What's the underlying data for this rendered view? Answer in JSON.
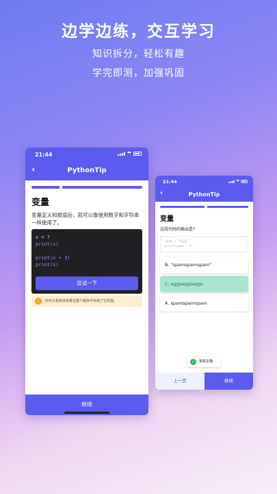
{
  "promo": {
    "title": "边学边练，交互学习",
    "subtitle1": "知识拆分，轻松有趣",
    "subtitle2": "学完即测，加强巩固"
  },
  "phone1": {
    "status_time": "21:44",
    "app_title": "PythonTip",
    "progress": 0.25,
    "lesson_title": "变量",
    "description": "变量定义和赋值后，就可以像使用数字和字符串一样使用了。",
    "code_lines": [
      "x = 7",
      "print(x)",
      "",
      "print(x + 3)",
      "print(x)"
    ],
    "try_button": "尝试一下",
    "tip": "你可以看到该变量在整个程序中存储了它的值。",
    "continue_button": "继续"
  },
  "phone2": {
    "status_time": "21:44",
    "app_title": "PythonTip",
    "progress": 0.5,
    "lesson_title": "变量",
    "question": "这段代码的输出是?",
    "code_lines": [
      "spam = \"eggs\"",
      "print(spam * 3)"
    ],
    "options": [
      {
        "label": "B. \"spamspamspam\"",
        "state": "normal"
      },
      {
        "label": "C. eggseggseggs",
        "state": "correct"
      },
      {
        "label": "A. spamspamspam",
        "state": "normal"
      }
    ],
    "toast": "答案正确",
    "prev_button": "上一页",
    "next_button": "继续"
  },
  "colors": {
    "accent": "#5b5bf0",
    "correct": "#a9e6cf",
    "tip_bg": "#fbefcf"
  }
}
